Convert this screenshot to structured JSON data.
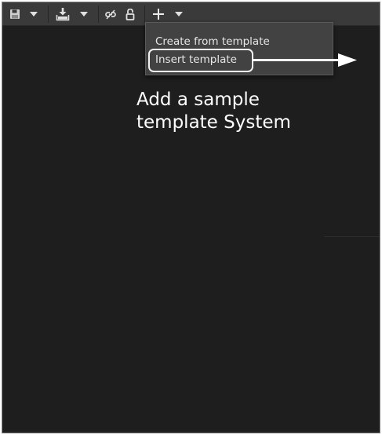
{
  "toolbar": {
    "buttons": [
      {
        "name": "save-button",
        "icon": "floppy-disk-icon"
      },
      {
        "name": "save-options-dropdown",
        "icon": "chevron-down-icon"
      },
      {
        "name": "import-button",
        "icon": "download-tray-icon"
      },
      {
        "name": "import-options-dropdown",
        "icon": "chevron-down-icon"
      },
      {
        "name": "link-button",
        "icon": "broken-link-icon"
      },
      {
        "name": "lock-button",
        "icon": "unlock-icon"
      },
      {
        "name": "add-button",
        "icon": "plus-icon"
      },
      {
        "name": "add-options-dropdown",
        "icon": "chevron-down-icon"
      }
    ]
  },
  "menu": {
    "items": [
      {
        "label": "Create from template"
      },
      {
        "label": "Insert template",
        "highlighted": true
      }
    ]
  },
  "annotation": {
    "line1": "Add a sample",
    "line2": "template System"
  },
  "colors": {
    "canvas": "#1e1e1e",
    "toolbar": "#3a3a3a",
    "menu": "#424242",
    "annotation": "#ffffff"
  }
}
